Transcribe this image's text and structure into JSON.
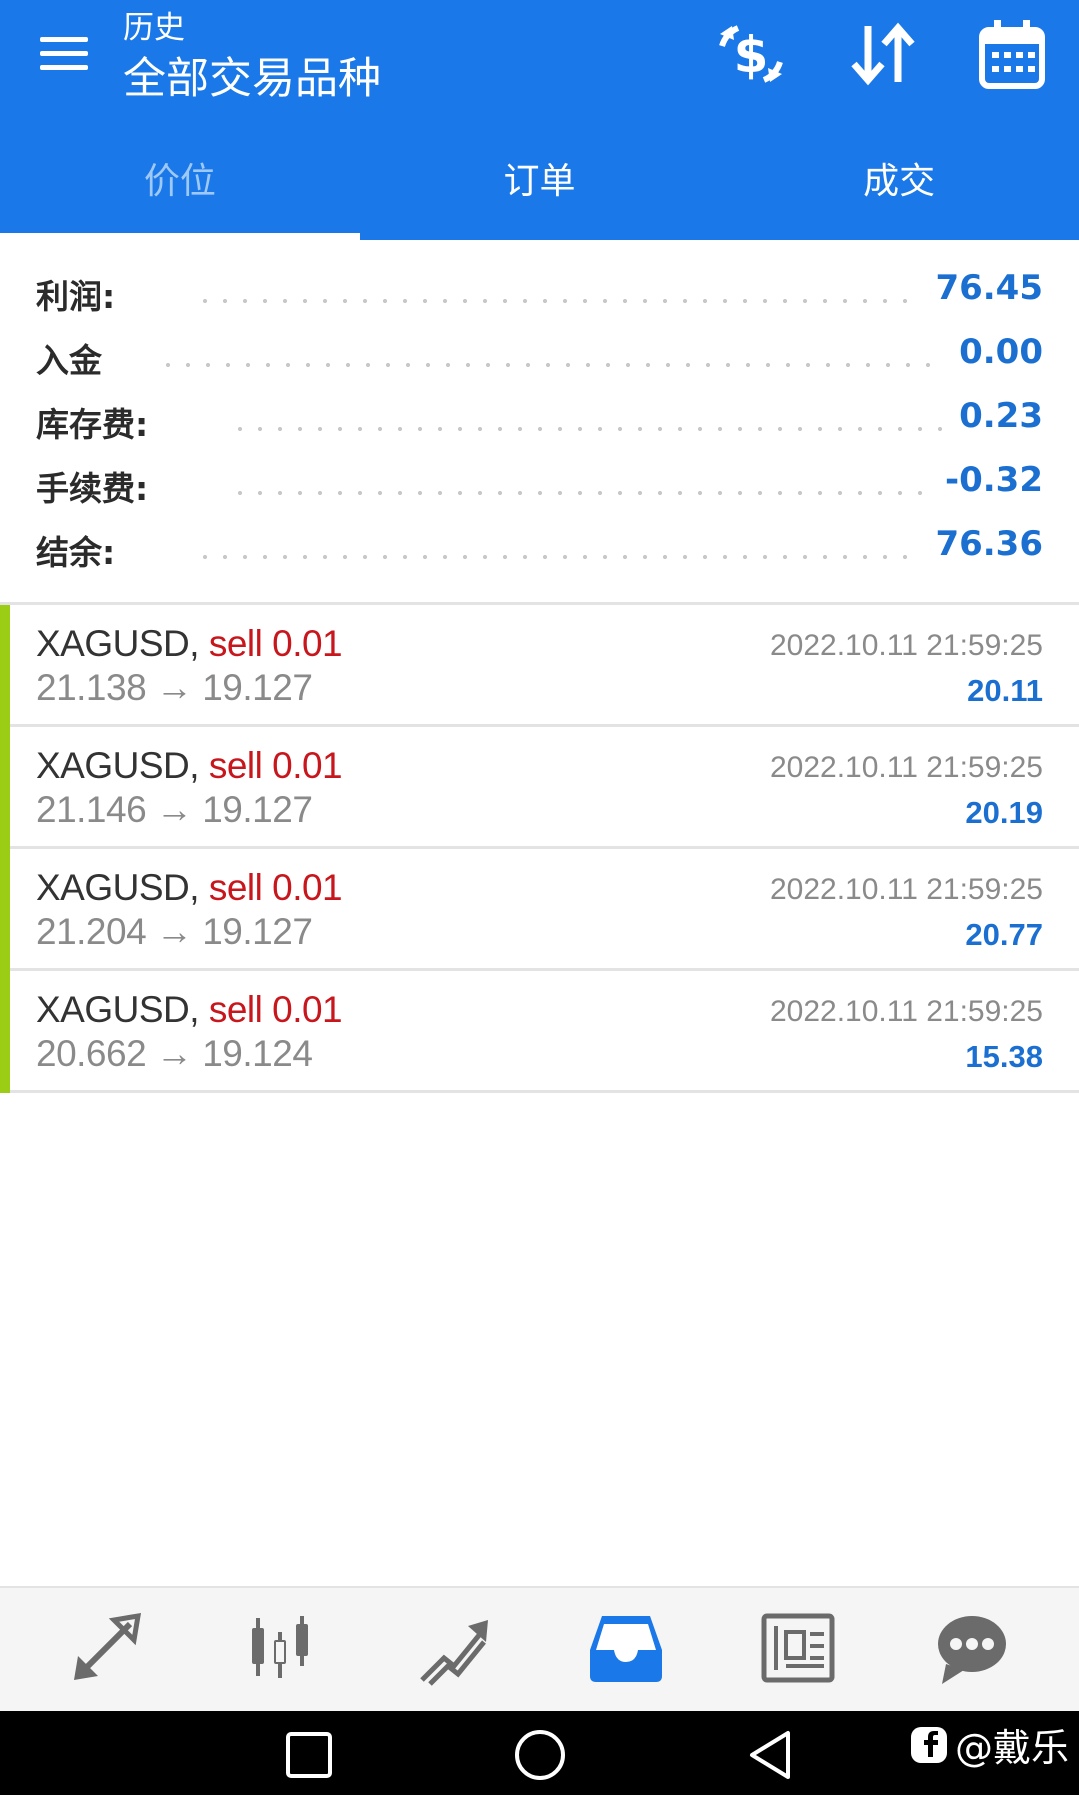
{
  "header": {
    "subtitle": "历史",
    "title": "全部交易品种"
  },
  "tabs": [
    {
      "label": "价位",
      "active": true
    },
    {
      "label": "订单",
      "active": false
    },
    {
      "label": "成交",
      "active": false
    }
  ],
  "summary": [
    {
      "label": "利润:",
      "value": "76.45"
    },
    {
      "label": "入金",
      "value": "0.00"
    },
    {
      "label": "库存费:",
      "value": "0.23"
    },
    {
      "label": "手续费:",
      "value": "-0.32"
    },
    {
      "label": "结余:",
      "value": "76.36"
    }
  ],
  "trades": [
    {
      "symbol": "XAGUSD,",
      "side": "sell 0.01",
      "prices": "21.138 → 19.127",
      "time": "2022.10.11 21:59:25",
      "profit": "20.11"
    },
    {
      "symbol": "XAGUSD,",
      "side": "sell 0.01",
      "prices": "21.146 → 19.127",
      "time": "2022.10.11 21:59:25",
      "profit": "20.19"
    },
    {
      "symbol": "XAGUSD,",
      "side": "sell 0.01",
      "prices": "21.204 → 19.127",
      "time": "2022.10.11 21:59:25",
      "profit": "20.77"
    },
    {
      "symbol": "XAGUSD,",
      "side": "sell 0.01",
      "prices": "20.662 → 19.124",
      "time": "2022.10.11 21:59:25",
      "profit": "15.38"
    }
  ],
  "watermark": "@戴乐",
  "colors": {
    "brand": "#1a78e8",
    "profit": "#1a6fd0",
    "sell": "#c8161d",
    "trade_bar": "#9acd14",
    "nav_active": "#1a78e8",
    "nav_inactive": "#6b6b6b"
  },
  "icons": {
    "header": [
      "menu-icon",
      "currency-exchange-icon",
      "sort-icon",
      "calendar-icon"
    ],
    "bottom_nav": [
      "quotes-icon",
      "chart-icon",
      "trade-icon",
      "history-icon",
      "news-icon",
      "chat-icon"
    ],
    "system": [
      "recents-icon",
      "home-icon",
      "back-icon"
    ]
  }
}
